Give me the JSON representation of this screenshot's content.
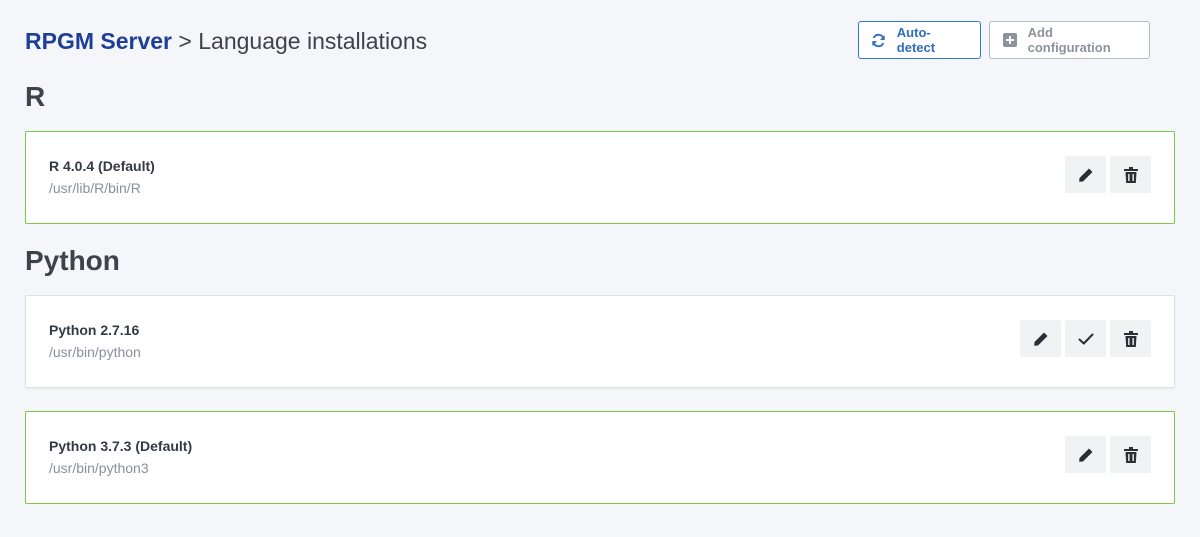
{
  "breadcrumb": {
    "root": "RPGM Server",
    "separator": ">",
    "current": "Language installations"
  },
  "toolbar": {
    "auto_detect_label": "Auto-detect",
    "add_config_label": "Add configuration"
  },
  "sections": [
    {
      "title": "R",
      "installations": [
        {
          "name": "R 4.0.4 (Default)",
          "path": "/usr/lib/R/bin/R",
          "is_default": true
        }
      ]
    },
    {
      "title": "Python",
      "installations": [
        {
          "name": "Python 2.7.16",
          "path": "/usr/bin/python",
          "is_default": false
        },
        {
          "name": "Python 3.7.3 (Default)",
          "path": "/usr/bin/python3",
          "is_default": true
        }
      ]
    }
  ],
  "colors": {
    "brand_link": "#1d3f9a",
    "primary": "#2f6cc0",
    "default_border": "#7ac943",
    "background": "#f5f6f9"
  },
  "icons": {
    "auto_detect": "refresh-icon",
    "add_config": "plus-square-icon",
    "edit": "pencil-icon",
    "set_default": "check-icon",
    "delete": "trash-icon"
  }
}
